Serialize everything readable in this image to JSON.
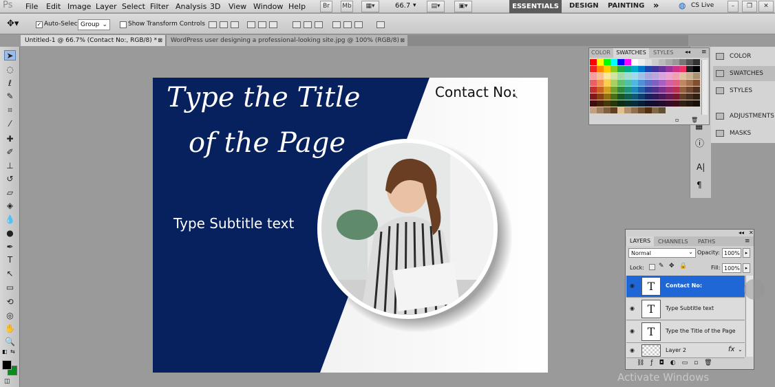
{
  "app": {
    "logo": "Ps",
    "menus": [
      "File",
      "Edit",
      "Image",
      "Layer",
      "Select",
      "Filter",
      "Analysis",
      "3D",
      "View",
      "Window",
      "Help"
    ],
    "zoom": "66.7",
    "workspaces": [
      "ESSENTIALS",
      "DESIGN",
      "PAINTING"
    ],
    "cs_live": "CS Live"
  },
  "options": {
    "auto_select_label": "Auto-Select:",
    "auto_select_value": "Group",
    "transform_label": "Show Transform Controls"
  },
  "tabs": [
    "Untitled-1 @ 66.7% (Contact No:, RGB/8) *",
    "WordPress user designing a professional-looking site.jpg @ 100% (RGB/8)"
  ],
  "canvas": {
    "title_line1": "Type the Title",
    "title_line2": "of the Page",
    "subtitle": "Type Subtitle text",
    "contact": "Contact No:",
    "colors": {
      "navy": "#06215e",
      "bg": "#ffffff"
    }
  },
  "swatches_panel": {
    "tabs": [
      "COLOR",
      "SWATCHES",
      "STYLES"
    ]
  },
  "dock": {
    "items": [
      "COLOR",
      "SWATCHES",
      "STYLES",
      "ADJUSTMENTS",
      "MASKS"
    ]
  },
  "layers_panel": {
    "tabs": [
      "LAYERS",
      "CHANNELS",
      "PATHS"
    ],
    "blend_mode": "Normal",
    "opacity_label": "Opacity:",
    "opacity": "100%",
    "lock_label": "Lock:",
    "fill_label": "Fill:",
    "fill": "100%",
    "layers": [
      {
        "name": "Contact No:",
        "type": "T",
        "selected": true
      },
      {
        "name": "Type Subtitle text",
        "type": "T",
        "selected": false
      },
      {
        "name": "Type the Title  of the Page",
        "type": "T",
        "selected": false
      },
      {
        "name": "Layer 2",
        "type": "image",
        "selected": false
      }
    ]
  },
  "watermark": "Activate Windows"
}
